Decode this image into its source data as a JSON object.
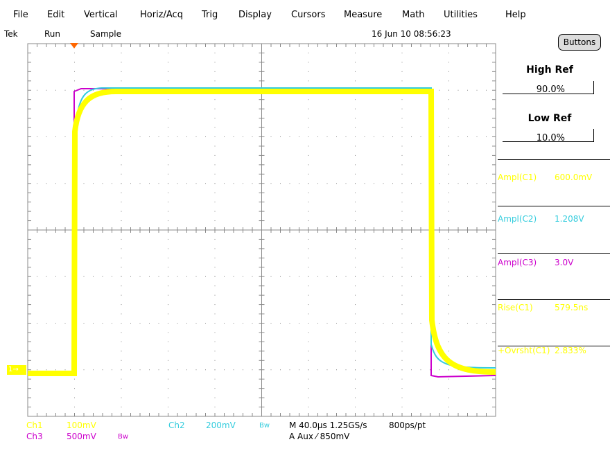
{
  "menu": [
    "File",
    "Edit",
    "Vertical",
    "Horiz/Acq",
    "Trig",
    "Display",
    "Cursors",
    "Measure",
    "Math",
    "Utilities",
    "Help"
  ],
  "status": {
    "brand": "Tek",
    "run": "Run",
    "mode": "Sample",
    "datetime": "16 Jun 10 08:56:23"
  },
  "buttons_label": "Buttons",
  "refs": {
    "high_title": "High Ref",
    "high_value": "90.0%",
    "low_title": "Low Ref",
    "low_value": "10.0%"
  },
  "measurements": [
    {
      "label": "Ampl(C1)",
      "value": "600.0mV",
      "color": "#ffff00"
    },
    {
      "label": "Ampl(C2)",
      "value": "1.208V",
      "color": "#33ccdd"
    },
    {
      "label": "Ampl(C3)",
      "value": "3.0V",
      "color": "#cc00cc"
    },
    {
      "label": "Rise(C1)",
      "value": "579.5ns",
      "color": "#ffff00"
    },
    {
      "label": "+Ovrsht(C1)",
      "value": "2.833%",
      "color": "#ffff00"
    }
  ],
  "footer": {
    "ch1": "Ch1",
    "ch1_scale": "100mV",
    "ch2": "Ch2",
    "ch2_scale": "200mV",
    "ch3": "Ch3",
    "ch3_scale": "500mV",
    "bw": "Bw",
    "timebase": "M 40.0µs 1.25GS/s",
    "resolution": "800ps/pt",
    "trigger": "A  Aux  ⁄  850mV",
    "ch1_marker": "1→"
  },
  "colors": {
    "ch1": "#ffff00",
    "ch2": "#33ccdd",
    "ch3": "#cc00cc",
    "grid": "#888888",
    "trigger_marker": "#ff6600"
  }
}
